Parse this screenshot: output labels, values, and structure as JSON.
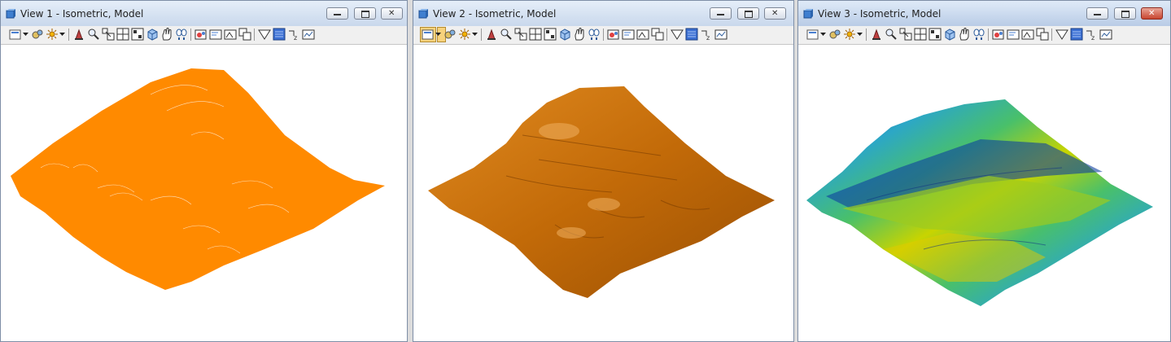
{
  "windows": [
    {
      "id": "view1",
      "title": "View 1 - Isometric, Model",
      "render_mode": "wireframe",
      "surface_color": "#ff8a00"
    },
    {
      "id": "view2",
      "title": "View 2 - Isometric, Model",
      "render_mode": "smooth-shaded",
      "surface_color": "#c26a08"
    },
    {
      "id": "view3",
      "title": "View 3 - Isometric, Model",
      "render_mode": "elevation-shaded",
      "surface_color": "#1f5fb0"
    }
  ],
  "toolbar_icons": [
    "view-attributes-icon",
    "display-style-icon",
    "lighting-icon",
    "update-view-icon",
    "zoom-in-icon",
    "zoom-out-icon",
    "window-area-icon",
    "fit-view-icon",
    "rotate-view-icon",
    "pan-view-icon",
    "view-previous-icon",
    "view-next-icon",
    "copy-view-icon",
    "clip-volume-icon",
    "clip-mask-icon",
    "change-view-perspective-icon",
    "toggle-3d-icon",
    "camera-icon",
    "view-settings-icon"
  ],
  "window_controls": [
    "minimize",
    "maximize",
    "close"
  ],
  "colors": {
    "titlebar": "#c9d8ec",
    "wire": "#ff8a00",
    "shaded": "#c26a08",
    "dtm_low": "#0b2a86",
    "dtm_mid": "#2ca7c6",
    "dtm_high": "#c8d400"
  }
}
